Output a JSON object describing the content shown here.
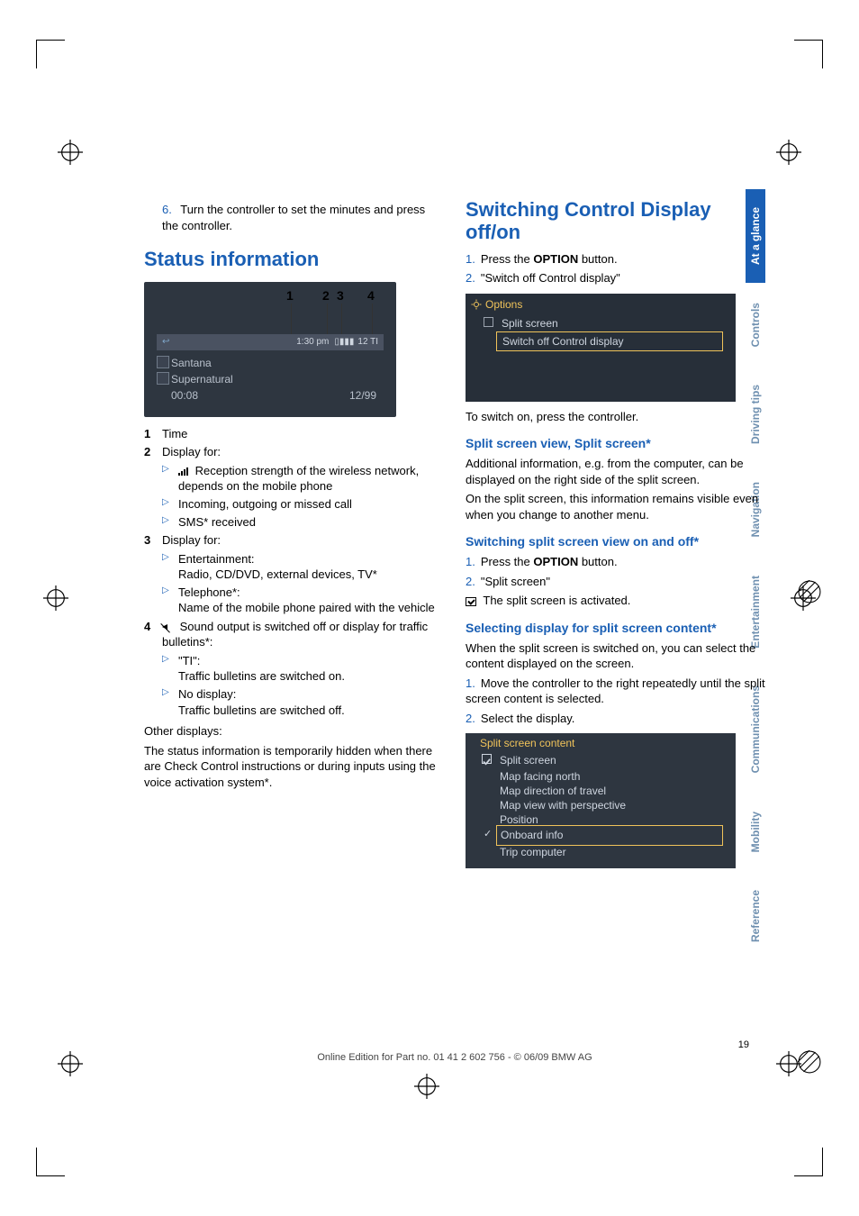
{
  "page_number": "19",
  "footer_text": "Online Edition for Part no. 01 41 2 602 756 - © 06/09 BMW AG",
  "side_tabs": [
    "At a glance",
    "Controls",
    "Driving tips",
    "Navigation",
    "Entertainment",
    "Communications",
    "Mobility",
    "Reference"
  ],
  "left": {
    "step6_num": "6.",
    "step6_text": "Turn the controller to set the minutes and press the controller.",
    "h_status": "Status information",
    "callouts": [
      "1",
      "2",
      "3",
      "4"
    ],
    "shot1": {
      "time": "1:30 pm",
      "signals": "  12   TI",
      "line1": "Santana",
      "line2": "Supernatural",
      "line3_left": "00:08",
      "line3_right": "12/99"
    },
    "items": {
      "n1": "1",
      "t1": "Time",
      "n2": "2",
      "t2": "Display for:",
      "t2a": " Reception strength of the wireless network, depends on the mobile phone",
      "t2b": "Incoming, outgoing or missed call",
      "t2c": "SMS* received",
      "n3": "3",
      "t3": "Display for:",
      "t3a_h": "Entertainment:",
      "t3a_b": "Radio, CD/DVD, external devices, TV*",
      "t3b_h": "Telephone*:",
      "t3b_b": "Name of the mobile phone paired with the vehicle",
      "n4": "4",
      "t4": " Sound output is switched off or display for traffic bulletins*:",
      "t4a_h": "\"TI\":",
      "t4a_b": "Traffic bulletins are switched on.",
      "t4b_h": "No display:",
      "t4b_b": "Traffic bulletins are switched off."
    },
    "other_h": "Other displays:",
    "other_b": "The status information is temporarily hidden when there are Check Control instructions or during inputs using the voice activation system*."
  },
  "right": {
    "h_switch": "Switching Control Display off/on",
    "s1_num": "1.",
    "s1_text_a": "Press the ",
    "s1_text_b": "OPTION",
    "s1_text_c": " button.",
    "s2_num": "2.",
    "s2_text": "\"Switch off Control display\"",
    "shot2": {
      "title": "Options",
      "row1": "Split screen",
      "row2": "Switch off Control display"
    },
    "after_shot2": "To switch on, press the controller.",
    "h_split": "Split screen view, Split screen*",
    "split_p1": "Additional information, e.g. from the computer, can be displayed on the right side of the split screen.",
    "split_p2": "On the split screen, this information remains visible even when you change to another menu.",
    "h_onoff": "Switching split screen view on and off*",
    "o1_num": "1.",
    "o1_a": "Press the ",
    "o1_b": "OPTION",
    "o1_c": " button.",
    "o2_num": "2.",
    "o2_text": "\"Split screen\"",
    "o_after": " The split screen is activated.",
    "h_select": "Selecting display for split screen content*",
    "sel_p": "When the split screen is switched on, you can select the content displayed on the screen.",
    "sel1_num": "1.",
    "sel1_text": "Move the controller to the right repeatedly until the split screen content is selected.",
    "sel2_num": "2.",
    "sel2_text": "Select the display.",
    "shot3": {
      "title": "Split screen content",
      "r1": "Split screen",
      "r2": "Map facing north",
      "r3": "Map direction of travel",
      "r4": "Map view with perspective",
      "r5": "Position",
      "r6": "Onboard info",
      "r7": "Trip computer"
    }
  }
}
